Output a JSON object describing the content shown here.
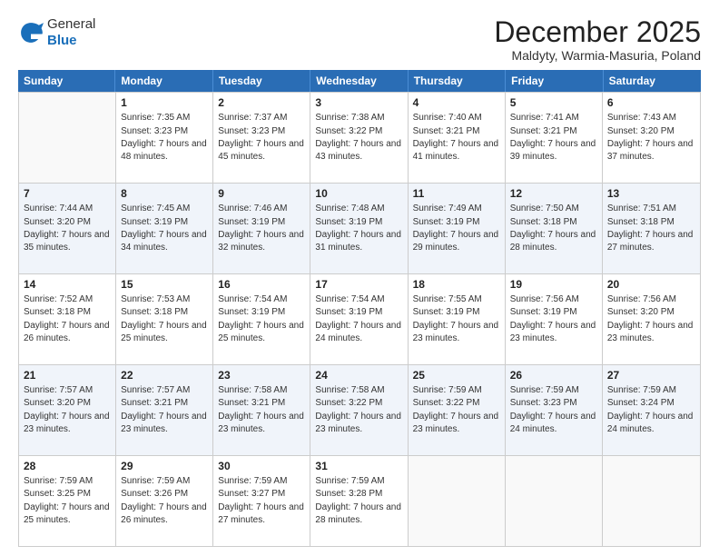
{
  "logo": {
    "general": "General",
    "blue": "Blue"
  },
  "title": "December 2025",
  "subtitle": "Maldyty, Warmia-Masuria, Poland",
  "days": [
    "Sunday",
    "Monday",
    "Tuesday",
    "Wednesday",
    "Thursday",
    "Friday",
    "Saturday"
  ],
  "rows": [
    [
      {
        "day": "",
        "empty": true
      },
      {
        "day": "1",
        "sunrise": "Sunrise: 7:35 AM",
        "sunset": "Sunset: 3:23 PM",
        "daylight": "Daylight: 7 hours and 48 minutes."
      },
      {
        "day": "2",
        "sunrise": "Sunrise: 7:37 AM",
        "sunset": "Sunset: 3:23 PM",
        "daylight": "Daylight: 7 hours and 45 minutes."
      },
      {
        "day": "3",
        "sunrise": "Sunrise: 7:38 AM",
        "sunset": "Sunset: 3:22 PM",
        "daylight": "Daylight: 7 hours and 43 minutes."
      },
      {
        "day": "4",
        "sunrise": "Sunrise: 7:40 AM",
        "sunset": "Sunset: 3:21 PM",
        "daylight": "Daylight: 7 hours and 41 minutes."
      },
      {
        "day": "5",
        "sunrise": "Sunrise: 7:41 AM",
        "sunset": "Sunset: 3:21 PM",
        "daylight": "Daylight: 7 hours and 39 minutes."
      },
      {
        "day": "6",
        "sunrise": "Sunrise: 7:43 AM",
        "sunset": "Sunset: 3:20 PM",
        "daylight": "Daylight: 7 hours and 37 minutes."
      }
    ],
    [
      {
        "day": "7",
        "sunrise": "Sunrise: 7:44 AM",
        "sunset": "Sunset: 3:20 PM",
        "daylight": "Daylight: 7 hours and 35 minutes."
      },
      {
        "day": "8",
        "sunrise": "Sunrise: 7:45 AM",
        "sunset": "Sunset: 3:19 PM",
        "daylight": "Daylight: 7 hours and 34 minutes."
      },
      {
        "day": "9",
        "sunrise": "Sunrise: 7:46 AM",
        "sunset": "Sunset: 3:19 PM",
        "daylight": "Daylight: 7 hours and 32 minutes."
      },
      {
        "day": "10",
        "sunrise": "Sunrise: 7:48 AM",
        "sunset": "Sunset: 3:19 PM",
        "daylight": "Daylight: 7 hours and 31 minutes."
      },
      {
        "day": "11",
        "sunrise": "Sunrise: 7:49 AM",
        "sunset": "Sunset: 3:19 PM",
        "daylight": "Daylight: 7 hours and 29 minutes."
      },
      {
        "day": "12",
        "sunrise": "Sunrise: 7:50 AM",
        "sunset": "Sunset: 3:18 PM",
        "daylight": "Daylight: 7 hours and 28 minutes."
      },
      {
        "day": "13",
        "sunrise": "Sunrise: 7:51 AM",
        "sunset": "Sunset: 3:18 PM",
        "daylight": "Daylight: 7 hours and 27 minutes."
      }
    ],
    [
      {
        "day": "14",
        "sunrise": "Sunrise: 7:52 AM",
        "sunset": "Sunset: 3:18 PM",
        "daylight": "Daylight: 7 hours and 26 minutes."
      },
      {
        "day": "15",
        "sunrise": "Sunrise: 7:53 AM",
        "sunset": "Sunset: 3:18 PM",
        "daylight": "Daylight: 7 hours and 25 minutes."
      },
      {
        "day": "16",
        "sunrise": "Sunrise: 7:54 AM",
        "sunset": "Sunset: 3:19 PM",
        "daylight": "Daylight: 7 hours and 25 minutes."
      },
      {
        "day": "17",
        "sunrise": "Sunrise: 7:54 AM",
        "sunset": "Sunset: 3:19 PM",
        "daylight": "Daylight: 7 hours and 24 minutes."
      },
      {
        "day": "18",
        "sunrise": "Sunrise: 7:55 AM",
        "sunset": "Sunset: 3:19 PM",
        "daylight": "Daylight: 7 hours and 23 minutes."
      },
      {
        "day": "19",
        "sunrise": "Sunrise: 7:56 AM",
        "sunset": "Sunset: 3:19 PM",
        "daylight": "Daylight: 7 hours and 23 minutes."
      },
      {
        "day": "20",
        "sunrise": "Sunrise: 7:56 AM",
        "sunset": "Sunset: 3:20 PM",
        "daylight": "Daylight: 7 hours and 23 minutes."
      }
    ],
    [
      {
        "day": "21",
        "sunrise": "Sunrise: 7:57 AM",
        "sunset": "Sunset: 3:20 PM",
        "daylight": "Daylight: 7 hours and 23 minutes."
      },
      {
        "day": "22",
        "sunrise": "Sunrise: 7:57 AM",
        "sunset": "Sunset: 3:21 PM",
        "daylight": "Daylight: 7 hours and 23 minutes."
      },
      {
        "day": "23",
        "sunrise": "Sunrise: 7:58 AM",
        "sunset": "Sunset: 3:21 PM",
        "daylight": "Daylight: 7 hours and 23 minutes."
      },
      {
        "day": "24",
        "sunrise": "Sunrise: 7:58 AM",
        "sunset": "Sunset: 3:22 PM",
        "daylight": "Daylight: 7 hours and 23 minutes."
      },
      {
        "day": "25",
        "sunrise": "Sunrise: 7:59 AM",
        "sunset": "Sunset: 3:22 PM",
        "daylight": "Daylight: 7 hours and 23 minutes."
      },
      {
        "day": "26",
        "sunrise": "Sunrise: 7:59 AM",
        "sunset": "Sunset: 3:23 PM",
        "daylight": "Daylight: 7 hours and 24 minutes."
      },
      {
        "day": "27",
        "sunrise": "Sunrise: 7:59 AM",
        "sunset": "Sunset: 3:24 PM",
        "daylight": "Daylight: 7 hours and 24 minutes."
      }
    ],
    [
      {
        "day": "28",
        "sunrise": "Sunrise: 7:59 AM",
        "sunset": "Sunset: 3:25 PM",
        "daylight": "Daylight: 7 hours and 25 minutes."
      },
      {
        "day": "29",
        "sunrise": "Sunrise: 7:59 AM",
        "sunset": "Sunset: 3:26 PM",
        "daylight": "Daylight: 7 hours and 26 minutes."
      },
      {
        "day": "30",
        "sunrise": "Sunrise: 7:59 AM",
        "sunset": "Sunset: 3:27 PM",
        "daylight": "Daylight: 7 hours and 27 minutes."
      },
      {
        "day": "31",
        "sunrise": "Sunrise: 7:59 AM",
        "sunset": "Sunset: 3:28 PM",
        "daylight": "Daylight: 7 hours and 28 minutes."
      },
      {
        "day": "",
        "empty": true
      },
      {
        "day": "",
        "empty": true
      },
      {
        "day": "",
        "empty": true
      }
    ]
  ]
}
